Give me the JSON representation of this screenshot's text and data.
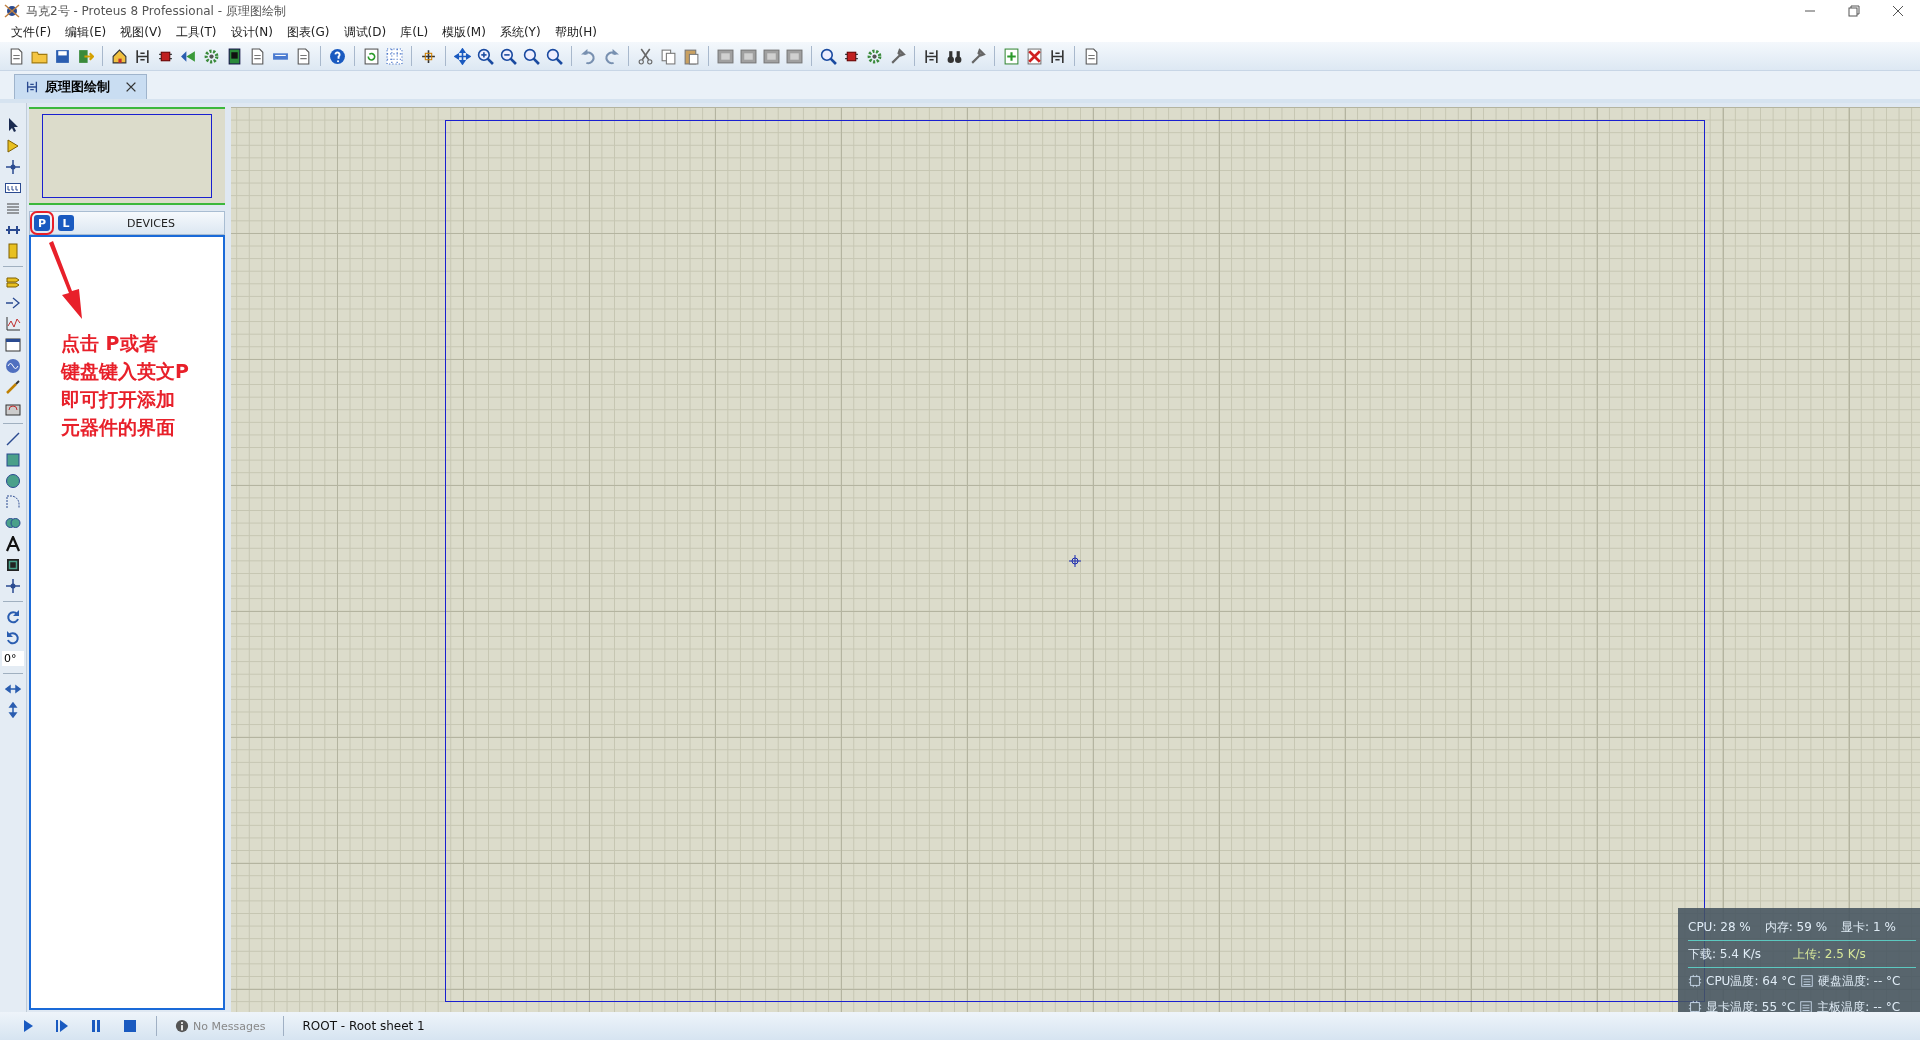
{
  "window": {
    "title": "马克2号 - Proteus 8 Professional - 原理图绘制"
  },
  "menu": [
    "文件(F)",
    "编辑(E)",
    "视图(V)",
    "工具(T)",
    "设计(N)",
    "图表(G)",
    "调试(D)",
    "库(L)",
    "模版(M)",
    "系统(Y)",
    "帮助(H)"
  ],
  "tabs": [
    {
      "label": "原理图绘制",
      "selected": true
    }
  ],
  "panel": {
    "mode_buttons": [
      "P",
      "L"
    ],
    "title": "DEVICES"
  },
  "annotation": {
    "lines": [
      "点击 P或者",
      "键盘键入英文P",
      "即可打开添加",
      "元器件的界面"
    ]
  },
  "rotation": "0°",
  "status": {
    "messages": "No Messages",
    "sheet": "ROOT - Root sheet 1"
  },
  "monitor": {
    "rows": [
      {
        "kind": "stats",
        "items": [
          "CPU: 28 %",
          "内存: 59 %",
          "显卡: 1 %"
        ]
      },
      {
        "kind": "net",
        "items": [
          "下载: 5.4 K/s",
          "上传: 2.5 K/s"
        ]
      },
      {
        "kind": "temps",
        "items": [
          "CPU温度: 64 °C",
          "硬盘温度: -- °C"
        ]
      },
      {
        "kind": "temps",
        "items": [
          "显卡温度: 55 °C",
          "主板温度: -- °C"
        ]
      }
    ]
  }
}
